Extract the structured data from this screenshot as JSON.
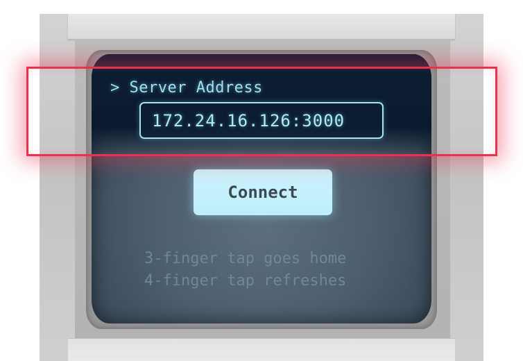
{
  "screen": {
    "prompt_label": "> Server Address",
    "address_field": {
      "value": "172.24.16.126:3000",
      "placeholder": ""
    },
    "connect_button_label": "Connect",
    "hints": [
      "3-finger tap goes home",
      "4-finger tap refreshes"
    ]
  },
  "colors": {
    "highlight": "#e8334f",
    "text_glow": "#9fe0ee",
    "button_bg": "#c4f0fc",
    "screen_dark": "#0a1a2e"
  },
  "icons": []
}
